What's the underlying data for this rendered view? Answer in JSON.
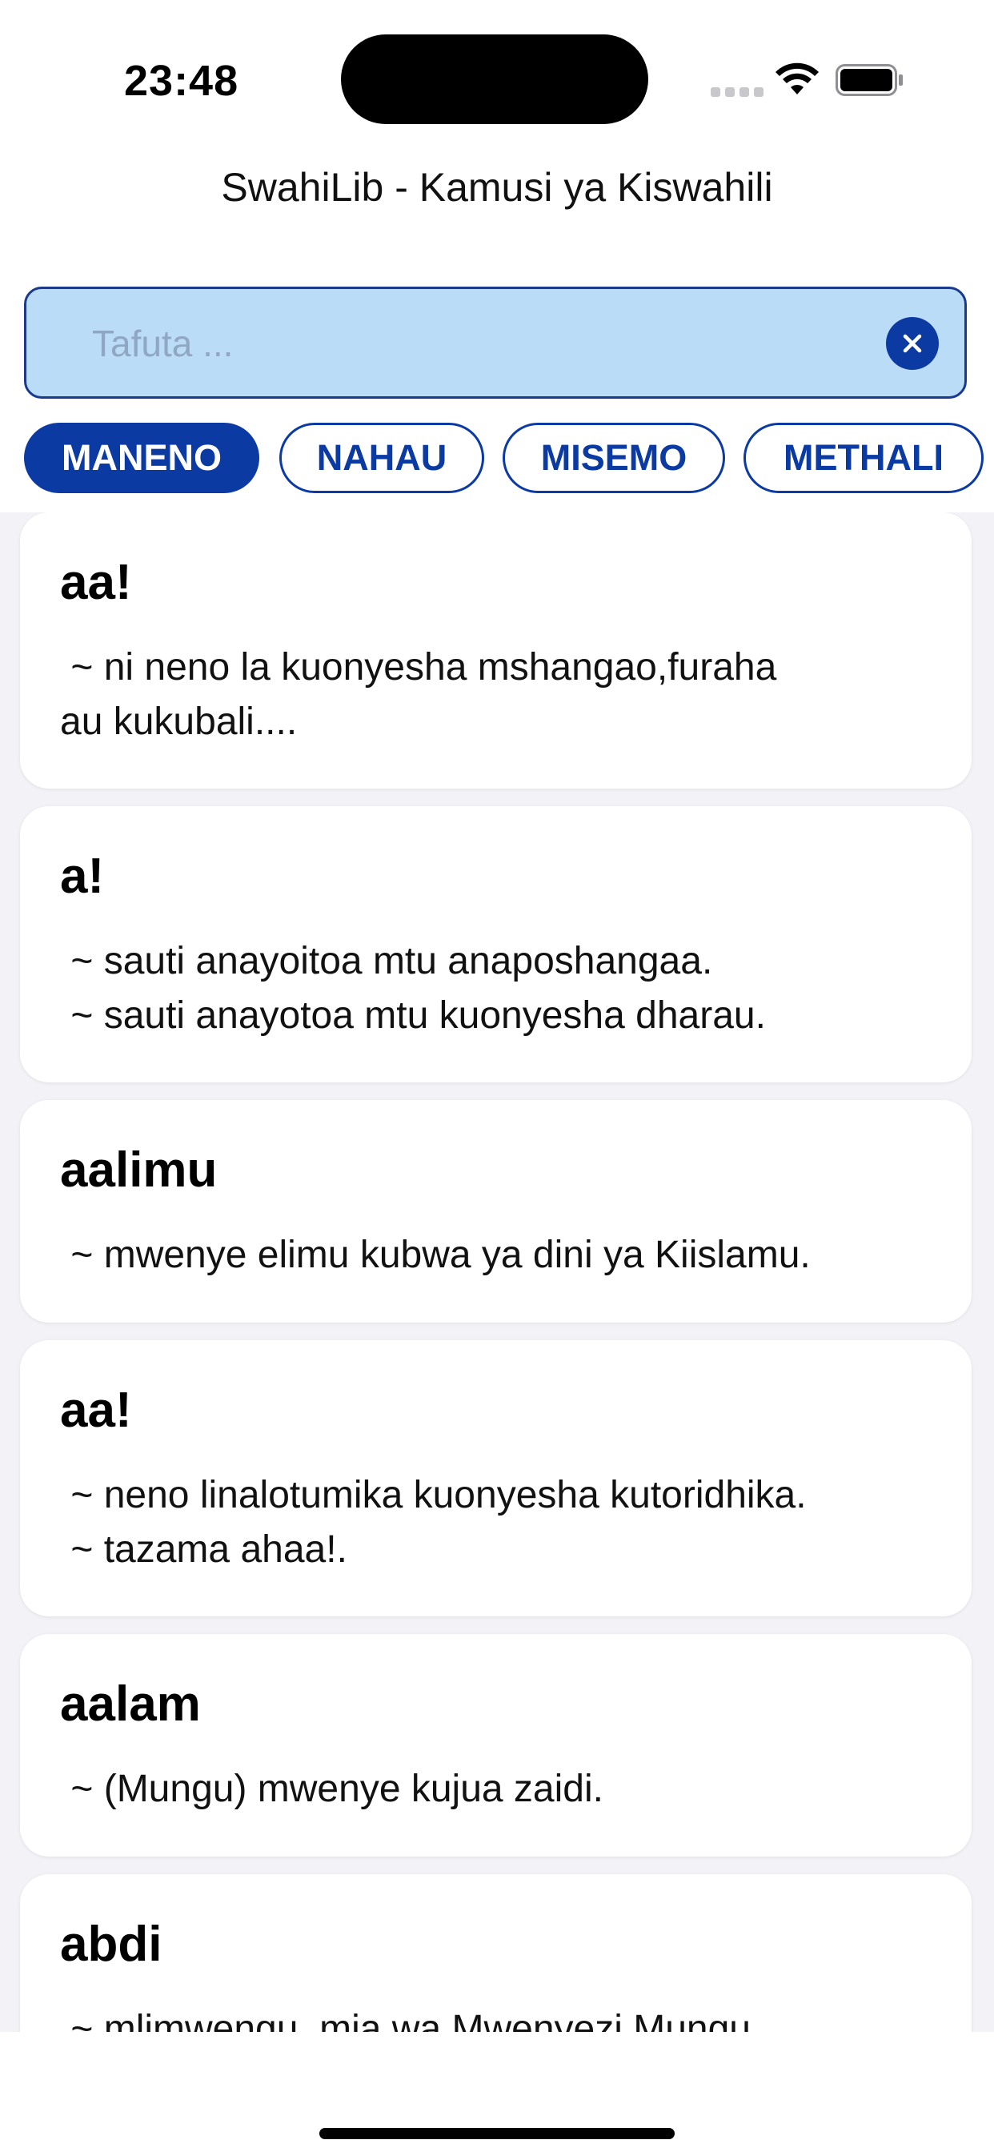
{
  "status_bar": {
    "time": "23:48"
  },
  "header": {
    "title": "SwahiLib - Kamusi ya Kiswahili"
  },
  "search": {
    "placeholder": "Tafuta ...",
    "value": ""
  },
  "tabs": [
    {
      "label": "MANENO",
      "active": true
    },
    {
      "label": "NAHAU",
      "active": false
    },
    {
      "label": "MISEMO",
      "active": false
    },
    {
      "label": "METHALI",
      "active": false
    }
  ],
  "entries": [
    {
      "word": "aa!",
      "meaning": " ~ ni neno la kuonyesha mshangao,furaha\nau kukubali...."
    },
    {
      "word": "a!",
      "meaning": " ~ sauti anayoitoa mtu anaposhangaa.\n ~ sauti anayotoa mtu kuonyesha dharau."
    },
    {
      "word": "aalimu",
      "meaning": " ~ mwenye elimu kubwa ya dini ya Kiislamu."
    },
    {
      "word": "aa!",
      "meaning": " ~ neno linalotumika kuonyesha kutoridhika.\n ~ tazama ahaa!."
    },
    {
      "word": "aalam",
      "meaning": " ~ (Mungu) mwenye kujua zaidi."
    },
    {
      "word": "abdi",
      "meaning": " ~ mlimwengu, mja wa Mwenyezi Mungu."
    }
  ],
  "colors": {
    "accent": "#0b3aa3",
    "search_bg": "#bbdcf7",
    "list_bg": "#f2f2f7"
  }
}
